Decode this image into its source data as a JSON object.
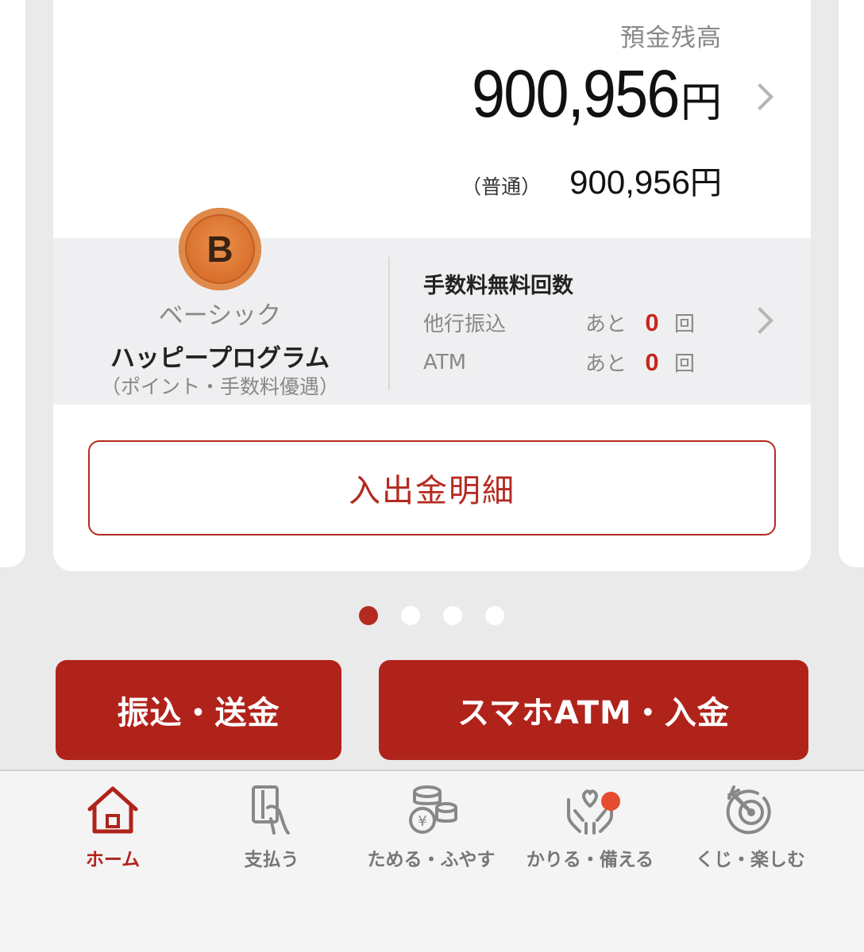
{
  "balance": {
    "label": "預金残高",
    "amount": "900,956",
    "currency": "円"
  },
  "account": {
    "type_label": "（普通）",
    "amount": "900,956",
    "currency": "円"
  },
  "program": {
    "badge_letter": "B",
    "tier": "ベーシック",
    "name": "ハッピープログラム",
    "subtitle": "（ポイント・手数料優遇）"
  },
  "fees": {
    "title": "手数料無料回数",
    "rows": [
      {
        "name": "他行振込",
        "prefix": "あと",
        "count": "0",
        "unit": "回"
      },
      {
        "name": "ATM",
        "prefix": "あと",
        "count": "0",
        "unit": "回"
      }
    ]
  },
  "history_button": "入出金明細",
  "pager": {
    "total": 4,
    "active": 1
  },
  "actions": {
    "transfer": "振込・送金",
    "atm": "スマホATM・入金"
  },
  "tabbar": {
    "items": [
      {
        "label": "ホーム",
        "icon": "home-icon",
        "active": true
      },
      {
        "label": "支払う",
        "icon": "card-hand-icon",
        "active": false
      },
      {
        "label": "ためる・ふやす",
        "icon": "coins-icon",
        "active": false
      },
      {
        "label": "かりる・備える",
        "icon": "hands-heart-icon",
        "active": false,
        "has_notification": true
      },
      {
        "label": "くじ・楽しむ",
        "icon": "target-icon",
        "active": false
      }
    ]
  },
  "colors": {
    "accent": "#b0231b",
    "count_red": "#c8261c",
    "badge_bronze": "#d9702d",
    "notification": "#e54b2f"
  }
}
